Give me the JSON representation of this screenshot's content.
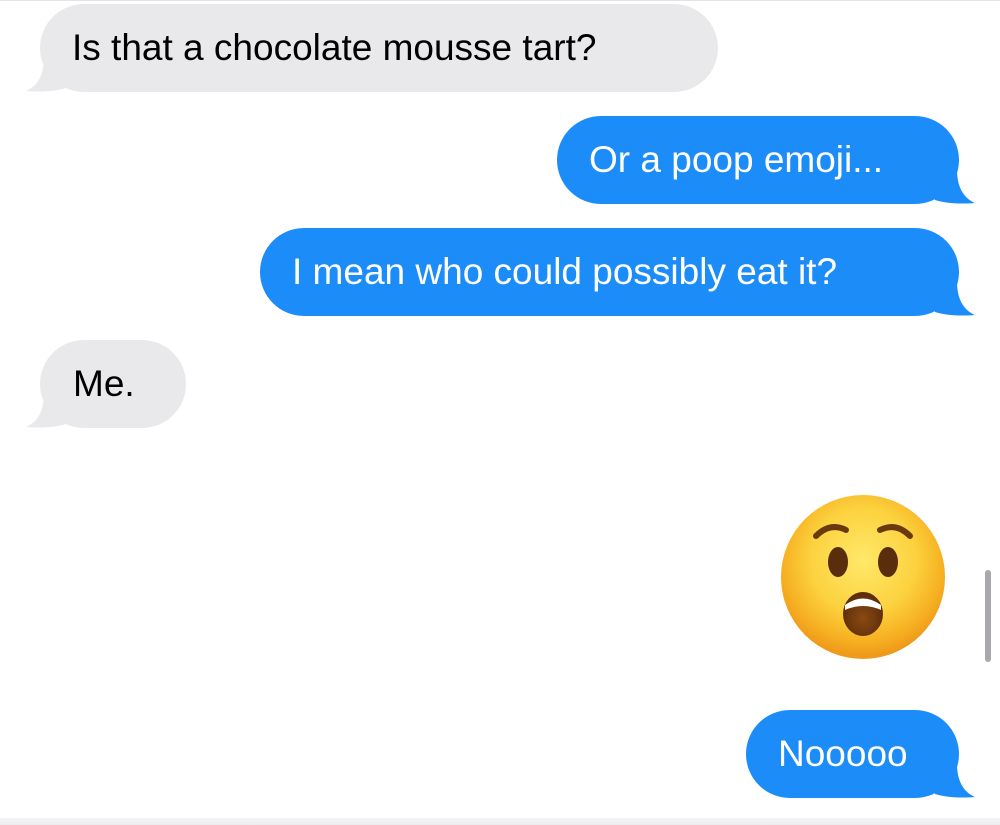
{
  "conversation": {
    "messages": [
      {
        "direction": "received",
        "text": "Is that a chocolate mousse tart?"
      },
      {
        "direction": "sent",
        "text": "Or a poop emoji..."
      },
      {
        "direction": "sent",
        "text": "I mean who could possibly eat it?"
      },
      {
        "direction": "received",
        "text": "Me."
      },
      {
        "direction": "sent",
        "emoji": "astonished-face-emoji"
      },
      {
        "direction": "sent",
        "text": "Nooooo"
      }
    ]
  },
  "colors": {
    "sent_bubble": "#1c8cf9",
    "received_bubble": "#e9e9eb",
    "background": "#ffffff"
  }
}
